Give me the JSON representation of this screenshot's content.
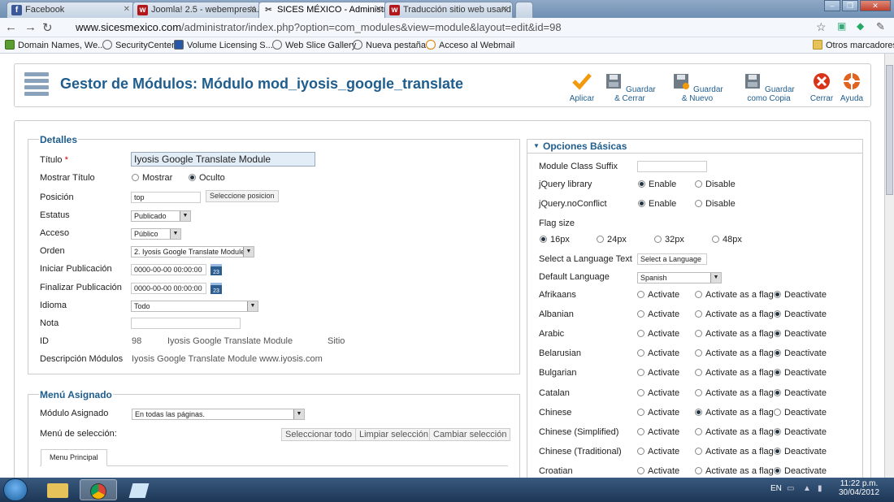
{
  "browser": {
    "tabs": [
      {
        "title": "Facebook",
        "favicon": "f",
        "color": "#3b5998"
      },
      {
        "title": "Joomla! 2.5 - webempresa.jo",
        "favicon": "w",
        "color": "#b3171b"
      },
      {
        "title": "SICES MÉXICO - Administra",
        "favicon": "✂",
        "color": "#666"
      },
      {
        "title": "Traducción sitio web usand",
        "favicon": "w",
        "color": "#b3171b"
      }
    ],
    "url_host": "www.sicesmexico.com",
    "url_path": "/administrator/index.php?option=com_modules&view=module&layout=edit&id=98",
    "bookmarks": [
      "Domain Names, We...",
      "SecurityCenter",
      "Volume Licensing S...",
      "Web Slice Gallery",
      "Nueva pestaña",
      "Acceso al Webmail"
    ],
    "other_bookmarks": "Otros marcadores"
  },
  "toolbar": {
    "title": "Gestor de Módulos: Módulo mod_iyosis_google_translate",
    "buttons": [
      {
        "label": "Aplicar",
        "icon": "check-icon"
      },
      {
        "label": "Guardar & Cerrar",
        "icon": "save-icon"
      },
      {
        "label": "Guardar & Nuevo",
        "icon": "save-new-icon"
      },
      {
        "label": "Guardar como Copia",
        "icon": "save-copy-icon"
      },
      {
        "label": "Cerrar",
        "icon": "close-icon"
      },
      {
        "label": "Ayuda",
        "icon": "help-icon"
      }
    ]
  },
  "details": {
    "legend": "Detalles",
    "title_label": "Título",
    "required_mark": "*",
    "title_value": "Iyosis Google Translate Module",
    "show_title_label": "Mostrar Título",
    "show_opt": "Mostrar",
    "hide_opt": "Oculto",
    "position_label": "Posición",
    "position_value": "top",
    "position_button": "Seleccione posicion",
    "status_label": "Estatus",
    "status_value": "Publicado",
    "access_label": "Acceso",
    "access_value": "Público",
    "order_label": "Orden",
    "order_value": "2. Iyosis Google Translate Module",
    "start_label": "Iniciar Publicación",
    "start_value": "0000-00-00 00:00:00",
    "end_label": "Finalizar Publicación",
    "end_value": "0000-00-00 00:00:00",
    "calendar_text": "23",
    "language_label": "Idioma",
    "language_value": "Todo",
    "note_label": "Nota",
    "note_value": "",
    "id_label": "ID",
    "id_value": "98",
    "id_module": "Iyosis Google Translate Module",
    "id_site": "Sitio",
    "desc_label": "Descripción Módulos",
    "desc_value": "Iyosis Google Translate Module www.iyosis.com"
  },
  "menu": {
    "legend": "Menú Asignado",
    "assign_label": "Módulo Asignado",
    "assign_value": "En todas las páginas.",
    "selection_label": "Menú de selección:",
    "btn_select_all": "Seleccionar todo",
    "btn_clear": "Limpiar selección",
    "btn_toggle": "Cambiar selección",
    "tab": "Menu Principal"
  },
  "options": {
    "header": "Opciones Básicas",
    "suffix_label": "Module Class Suffix",
    "jquery_label": "jQuery library",
    "noconflict_label": "jQuery.noConflict",
    "enable": "Enable",
    "disable": "Disable",
    "flag_size_label": "Flag size",
    "flag_sizes": [
      "16px",
      "24px",
      "32px",
      "48px"
    ],
    "lang_text_label": "Select a Language Text",
    "lang_text_value": "Select a Language",
    "default_lang_label": "Default Language",
    "default_lang_value": "Spanish",
    "activate": "Activate",
    "activate_flag": "Activate as a flag",
    "deactivate": "Deactivate",
    "languages": [
      {
        "name": "Afrikaans",
        "sel": "deactivate"
      },
      {
        "name": "Albanian",
        "sel": "deactivate"
      },
      {
        "name": "Arabic",
        "sel": "deactivate"
      },
      {
        "name": "Belarusian",
        "sel": "deactivate"
      },
      {
        "name": "Bulgarian",
        "sel": "deactivate"
      },
      {
        "name": "Catalan",
        "sel": "deactivate"
      },
      {
        "name": "Chinese",
        "sel": "flag"
      },
      {
        "name": "Chinese (Simplified)",
        "sel": "deactivate"
      },
      {
        "name": "Chinese (Traditional)",
        "sel": "deactivate"
      },
      {
        "name": "Croatian",
        "sel": "deactivate"
      }
    ]
  },
  "taskbar": {
    "lang": "EN",
    "time": "11:22 p.m.",
    "date": "30/04/2012"
  }
}
